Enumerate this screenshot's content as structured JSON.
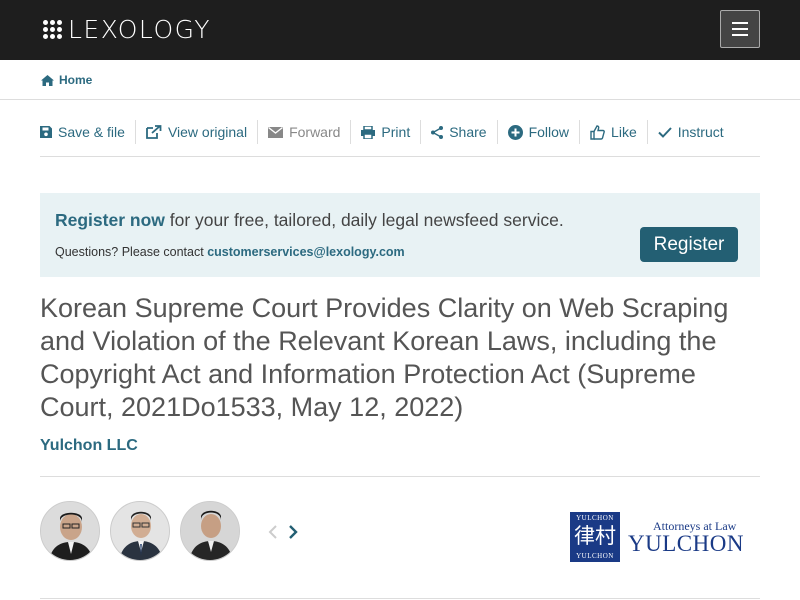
{
  "header": {
    "logo_text": "LEXOLOGY"
  },
  "breadcrumb": {
    "home_label": "Home"
  },
  "toolbar": {
    "items": [
      {
        "label": "Save & file",
        "icon": "save-icon"
      },
      {
        "label": "View original",
        "icon": "external-link-icon"
      },
      {
        "label": "Forward",
        "icon": "envelope-icon",
        "disabled": true
      },
      {
        "label": "Print",
        "icon": "print-icon"
      },
      {
        "label": "Share",
        "icon": "share-icon"
      },
      {
        "label": "Follow",
        "icon": "plus-circle-icon"
      },
      {
        "label": "Like",
        "icon": "thumbs-up-icon"
      },
      {
        "label": "Instruct",
        "icon": "check-icon"
      }
    ]
  },
  "banner": {
    "register_now": "Register now",
    "tagline": " for your free, tailored, daily legal newsfeed service.",
    "questions": "Questions? Please contact ",
    "email": "customerservices@lexology.com",
    "register_button": "Register"
  },
  "article": {
    "title": "Korean Supreme Court Provides Clarity on Web Scraping and Violation of the Relevant Korean Laws, including the Copyright Act and Information Protection Act (Supreme Court, 2021Do1533, May 12, 2022)",
    "author": "Yulchon LLC"
  },
  "firm_logo": {
    "seal_top": "YULCHON",
    "seal_chars": "律村",
    "seal_bottom": "YULCHON",
    "tagline": "Attorneys at Law",
    "name": "YULCHON"
  },
  "colors": {
    "accent": "#2c6a80",
    "header_bg": "#1e1e1e",
    "banner_bg": "#e8f2f4",
    "button_bg": "#235f73",
    "firm_blue": "#1a3a86"
  }
}
